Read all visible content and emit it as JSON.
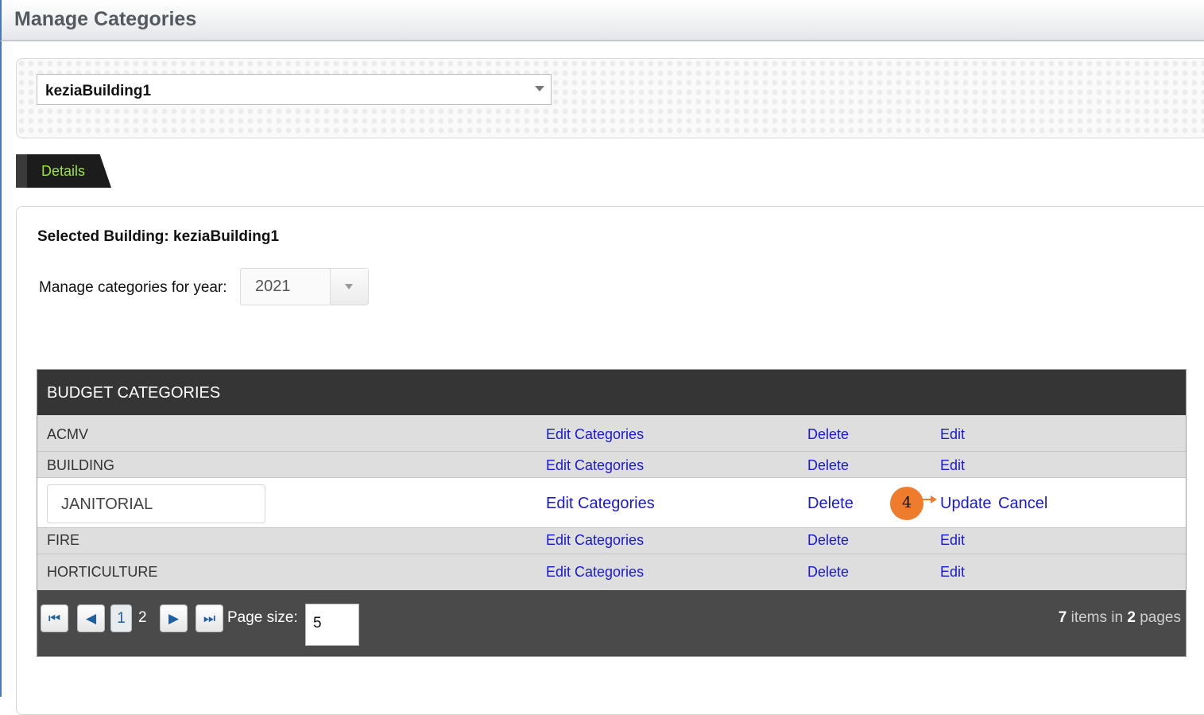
{
  "page": {
    "title": "Manage Categories"
  },
  "building_select": {
    "value": "keziaBuilding1"
  },
  "tabs": [
    {
      "label": "Details"
    }
  ],
  "details": {
    "selected_building_text": "Selected Building: keziaBuilding1",
    "year_label": "Manage categories for year:",
    "year_value": "2021"
  },
  "grid": {
    "title": "BUDGET CATEGORIES",
    "rows": [
      {
        "name": "ACMV",
        "edit_categories": "Edit Categories",
        "delete": "Delete",
        "edit": "Edit"
      },
      {
        "name": "BUILDING",
        "edit_categories": "Edit Categories",
        "delete": "Delete",
        "edit": "Edit"
      },
      {
        "name": "JANITORIAL",
        "edit_categories": "Edit Categories",
        "delete": "Delete",
        "update": "Update",
        "cancel": "Cancel"
      },
      {
        "name": "FIRE",
        "edit_categories": "Edit Categories",
        "delete": "Delete",
        "edit": "Edit"
      },
      {
        "name": "HORTICULTURE",
        "edit_categories": "Edit Categories",
        "delete": "Delete",
        "edit": "Edit"
      }
    ],
    "callout": {
      "number": "4",
      "color": "#ef7b2d"
    },
    "pager": {
      "pages": [
        "1",
        "2"
      ],
      "current_page": "1",
      "page_size_label": "Page size:",
      "page_size_value": "5",
      "total_items": "7",
      "items_text": "items in",
      "total_pages": "2",
      "pages_text": "pages"
    }
  },
  "icons": {
    "first": "first-page-icon",
    "prev": "previous-page-icon",
    "next": "next-page-icon",
    "last": "last-page-icon"
  }
}
